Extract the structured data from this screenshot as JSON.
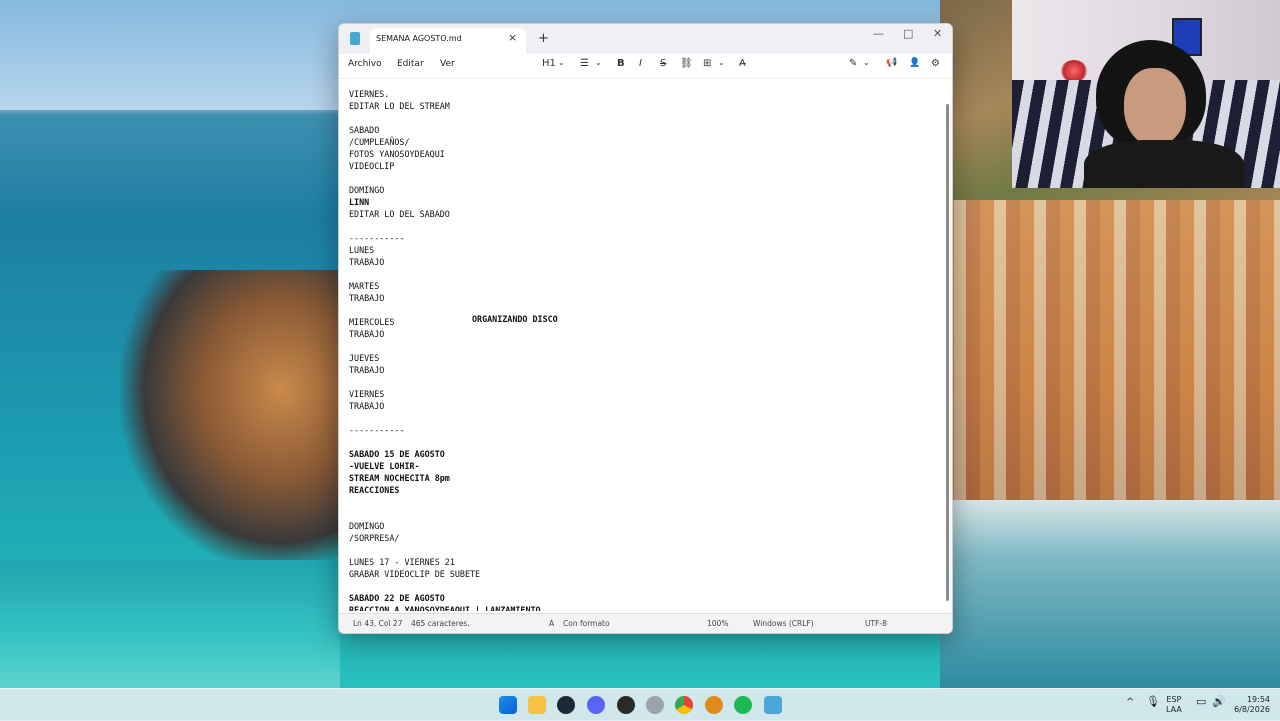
{
  "window": {
    "tab_title": "SEMANA AGOSTO.md",
    "new_tab_icon": "+",
    "close_tab_icon": "×",
    "controls": {
      "minimize": "—",
      "maximize": "□",
      "close": "✕"
    }
  },
  "menu": {
    "file": "Archivo",
    "edit": "Editar",
    "view": "Ver"
  },
  "toolbar": {
    "heading": "H1",
    "heading_caret": "⌄",
    "list": "☰",
    "list_caret": "⌄",
    "bold": "B",
    "italic": "I",
    "strike": "S",
    "link": "⛓",
    "table": "⊞",
    "table_caret": "⌄",
    "clear": "A̶",
    "copilot": "✎",
    "copilot_caret": "⌄",
    "share": "📢",
    "account": "👤",
    "settings": "⚙"
  },
  "editor": {
    "lines": [
      {
        "text": "VIERNES.",
        "bold": false
      },
      {
        "text": "EDITAR LO DEL STREAM",
        "bold": false
      },
      {
        "text": "",
        "bold": false
      },
      {
        "text": "SABADO",
        "bold": false
      },
      {
        "text": "/CUMPLEAÑOS/",
        "bold": false
      },
      {
        "text": "FOTOS YANOSOYDEAQUI",
        "bold": false
      },
      {
        "text": "VIDEOCLIP",
        "bold": false
      },
      {
        "text": "",
        "bold": false
      },
      {
        "text": "DOMINGO",
        "bold": false
      },
      {
        "text": "LINN",
        "bold": true
      },
      {
        "text": "EDITAR LO DEL SABADO",
        "bold": false
      },
      {
        "text": "",
        "bold": false
      },
      {
        "text": "-----------",
        "bold": false
      },
      {
        "text": "LUNES",
        "bold": false
      },
      {
        "text": "TRABAJO",
        "bold": false
      },
      {
        "text": "",
        "bold": false
      },
      {
        "text": "MARTES",
        "bold": false
      },
      {
        "text": "TRABAJO",
        "bold": false
      },
      {
        "text": "",
        "bold": false
      },
      {
        "text": "MIERCOLES",
        "bold": false
      },
      {
        "text": "TRABAJO",
        "bold": false
      },
      {
        "text": "",
        "bold": false
      },
      {
        "text": "JUEVES",
        "bold": false
      },
      {
        "text": "TRABAJO",
        "bold": false
      },
      {
        "text": "",
        "bold": false
      },
      {
        "text": "VIERNES",
        "bold": false
      },
      {
        "text": "TRABAJO",
        "bold": false
      },
      {
        "text": "",
        "bold": false
      },
      {
        "text": "-----------",
        "bold": false
      },
      {
        "text": "",
        "bold": false
      },
      {
        "text": "SABADO 15 DE AGOSTO",
        "bold": true
      },
      {
        "text": "-VUELVE LOHIR-",
        "bold": true
      },
      {
        "text": "STREAM NOCHECITA 8pm",
        "bold": true
      },
      {
        "text": "REACCIONES",
        "bold": true
      },
      {
        "text": "",
        "bold": false
      },
      {
        "text": "",
        "bold": false
      },
      {
        "text": "DOMINGO",
        "bold": false
      },
      {
        "text": "/SORPRESA/",
        "bold": false
      },
      {
        "text": "",
        "bold": false
      },
      {
        "text": "LUNES 17 - VIERNES 21",
        "bold": false
      },
      {
        "text": "GRABAR VIDEOCLIP DE SUBETE",
        "bold": false
      },
      {
        "text": "",
        "bold": false
      },
      {
        "text": "SABADO 22 DE AGOSTO",
        "bold": true
      },
      {
        "text": "REACCION A YANOSOYDEAQUI | LANZAMIENTO",
        "bold": true
      }
    ],
    "side_note": "ORGANIZANDO DISCO"
  },
  "status": {
    "position": "Ln 43, Col 27",
    "chars": "465 caracteres.",
    "format": "Con formato",
    "zoom": "100%",
    "line_endings": "Windows (CRLF)",
    "encoding": "UTF-8"
  },
  "taskbar": {
    "lang_top": "ESP",
    "lang_bottom": "LAA",
    "time": "19:54",
    "date": "6/8/2026",
    "chevron": "^"
  }
}
